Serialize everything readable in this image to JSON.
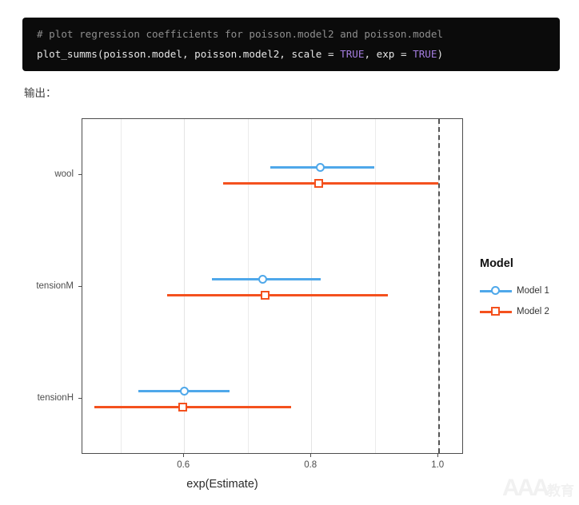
{
  "code_block": {
    "comment": "# plot regression coefficients for poisson.model2 and poisson.model",
    "call_part1": "plot_summs(poisson.model, poisson.model2, scale = ",
    "kw1": "TRUE",
    "call_part2": ", exp = ",
    "kw2": "TRUE",
    "call_part3": ")",
    "background": "#0b0b0b",
    "comment_color": "#8e8e8e",
    "keyword_color": "#a57ee0"
  },
  "output_label": "输出：",
  "legend": {
    "title": "Model",
    "items": [
      {
        "label": "Model 1",
        "color": "#4fa8ea",
        "symbol": "circle"
      },
      {
        "label": "Model 2",
        "color": "#f4511e",
        "symbol": "square"
      }
    ]
  },
  "watermark": {
    "letters": "AAA",
    "cn": "教育"
  },
  "chart_data": {
    "type": "scatter",
    "subtype": "coefficient-forest-plot",
    "title": "",
    "xlabel": "exp(Estimate)",
    "ylabel": "",
    "xlim": [
      0.44,
      1.04
    ],
    "xticks": [
      0.6,
      0.8,
      1.0
    ],
    "xtick_labels": [
      "0.6",
      "0.8",
      "1.0"
    ],
    "minor_gridlines": [
      0.5,
      0.7,
      0.9
    ],
    "grid": true,
    "legend_position": "right",
    "reference_line": {
      "x": 1.0,
      "style": "dashed",
      "color": "#555555"
    },
    "categories": [
      "wool",
      "tensionM",
      "tensionH"
    ],
    "series": [
      {
        "name": "Model 1",
        "color": "#4fa8ea",
        "symbol": "circle",
        "estimates": [
          0.814,
          0.724,
          0.6
        ],
        "ci_low": [
          0.735,
          0.644,
          0.528
        ],
        "ci_high": [
          0.899,
          0.815,
          0.672
        ]
      },
      {
        "name": "Model 2",
        "color": "#f4511e",
        "symbol": "square",
        "estimates": [
          0.812,
          0.727,
          0.598
        ],
        "ci_low": [
          0.661,
          0.573,
          0.459
        ],
        "ci_high": [
          1.0,
          0.921,
          0.768
        ]
      }
    ]
  }
}
